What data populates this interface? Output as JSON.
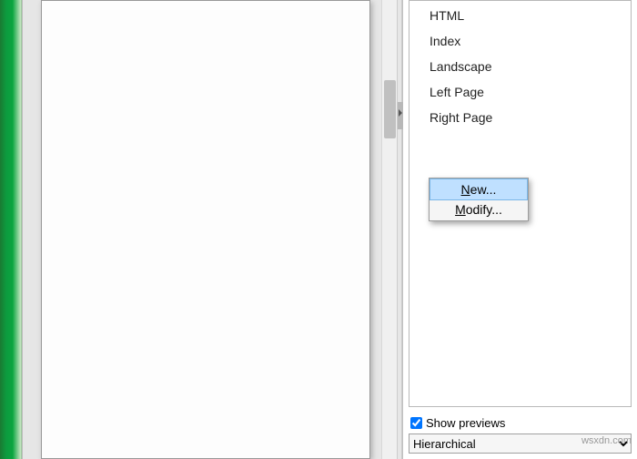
{
  "sidebar": {
    "styles": [
      {
        "label": "HTML"
      },
      {
        "label": "Index"
      },
      {
        "label": "Landscape"
      },
      {
        "label": "Left Page"
      },
      {
        "label": "Right Page"
      }
    ],
    "show_previews_label": "Show previews",
    "show_previews_checked": true,
    "mode_select": {
      "value": "Hierarchical",
      "options": [
        "Hierarchical"
      ]
    }
  },
  "context_menu": {
    "items": [
      {
        "label": "New...",
        "mnemonic": "N",
        "highlighted": true
      },
      {
        "label": "Modify...",
        "mnemonic": "M",
        "highlighted": false
      }
    ]
  },
  "watermark": "wsxdn.com"
}
